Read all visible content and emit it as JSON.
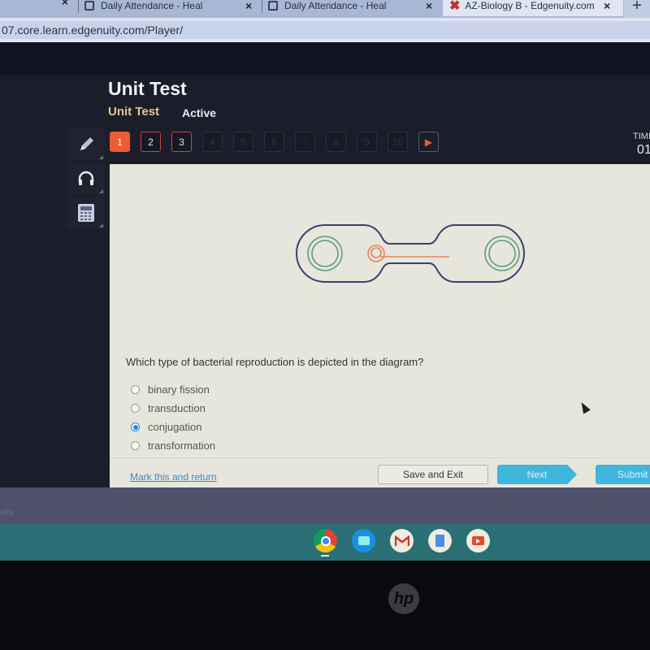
{
  "browser": {
    "tabs": [
      {
        "title": "Daily Attendance - Heal",
        "close": "×",
        "active": false
      },
      {
        "title": "Daily Attendance - Heal",
        "close": "×",
        "active": false
      },
      {
        "title": "AZ-Biology B - Edgenuity.com",
        "close": "×",
        "active": true
      }
    ],
    "first_tab_close": "×",
    "new_tab": "+",
    "url": "07.core.learn.edgenuity.com/Player/"
  },
  "header": {
    "title": "Unit Test",
    "subtitle": "Unit Test",
    "status": "Active",
    "timer_label": "TIME",
    "timer_value": "01"
  },
  "question_nav": {
    "items": [
      {
        "label": "1",
        "state": "current"
      },
      {
        "label": "2",
        "state": "visited"
      },
      {
        "label": "3",
        "state": "visited"
      },
      {
        "label": "4",
        "state": "disabled"
      },
      {
        "label": "5",
        "state": "disabled"
      },
      {
        "label": "6",
        "state": "disabled"
      },
      {
        "label": "7",
        "state": "disabled"
      },
      {
        "label": "8",
        "state": "disabled"
      },
      {
        "label": "9",
        "state": "disabled"
      },
      {
        "label": "10",
        "state": "disabled"
      }
    ],
    "next_glyph": "▶"
  },
  "tools": [
    {
      "name": "pencil-icon"
    },
    {
      "name": "headphones-icon"
    },
    {
      "name": "calculator-icon"
    }
  ],
  "diagram": {
    "description": "Two bacterial cells connected by a pilus bridge, plasmid transferring",
    "colors": {
      "cell_outline": "#3a4270",
      "chromosome": "#5e9a7c",
      "plasmid": "#e8835a"
    }
  },
  "question": {
    "text": "Which type of bacterial reproduction is depicted in the diagram?",
    "options": [
      {
        "label": "binary fission",
        "selected": false
      },
      {
        "label": "transduction",
        "selected": false
      },
      {
        "label": "conjugation",
        "selected": true
      },
      {
        "label": "transformation",
        "selected": false
      }
    ]
  },
  "footer": {
    "mark_link": "Mark this and return",
    "save_exit": "Save and Exit",
    "next": "Next",
    "submit": "Submit"
  },
  "os": {
    "watermark": "uity",
    "shelf_apps": [
      {
        "name": "chrome-icon",
        "active": true
      },
      {
        "name": "files-icon",
        "active": false
      },
      {
        "name": "gmail-icon",
        "active": false
      },
      {
        "name": "docs-icon",
        "active": false
      },
      {
        "name": "youtube-icon",
        "active": false
      }
    ],
    "laptop_logo": "hp"
  },
  "colors": {
    "accent_orange": "#ee5a32",
    "button_blue": "#40b6dd",
    "link_blue": "#3b8bc8",
    "radio_selected": "#1e88e5"
  }
}
